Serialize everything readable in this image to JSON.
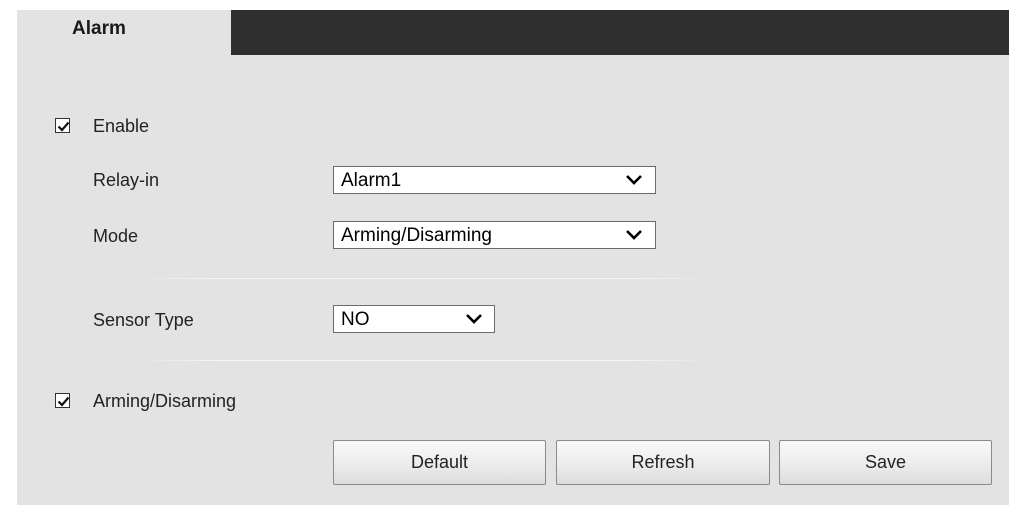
{
  "tab": {
    "title": "Alarm"
  },
  "enable": {
    "label": "Enable",
    "checked": true
  },
  "relay_in": {
    "label": "Relay-in",
    "value": "Alarm1"
  },
  "mode": {
    "label": "Mode",
    "value": "Arming/Disarming"
  },
  "sensor_type": {
    "label": "Sensor Type",
    "value": "NO"
  },
  "arming": {
    "label": "Arming/Disarming",
    "checked": true
  },
  "buttons": {
    "default_label": "Default",
    "refresh_label": "Refresh",
    "save_label": "Save"
  },
  "colors": {
    "panel_background": "#e3e3e3",
    "tab_bar": "#2f2f2f"
  },
  "icons": {
    "checkbox_mark": "check-icon",
    "dropdown": "chevron-down-icon"
  }
}
